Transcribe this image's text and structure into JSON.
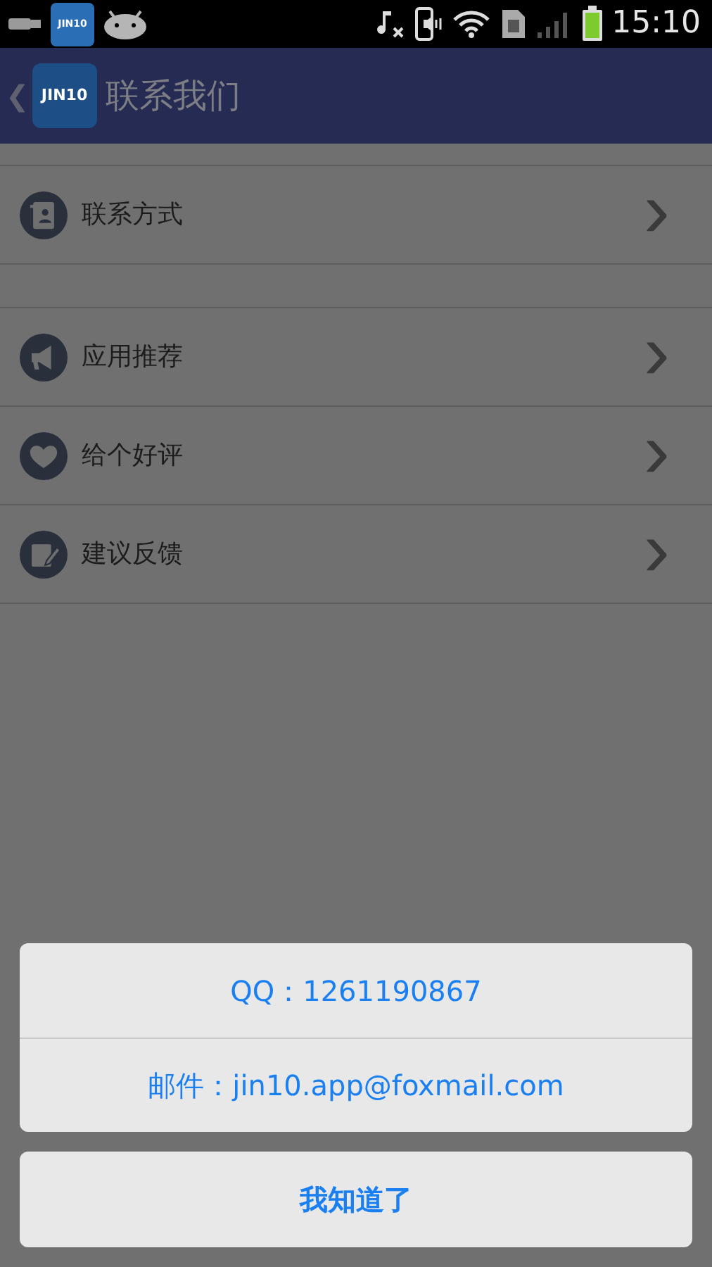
{
  "status_bar": {
    "app_logo_text": "JIN10",
    "time": "15:10"
  },
  "header": {
    "back": "❮",
    "logo_text": "JIN10",
    "title": "联系我们"
  },
  "menu_groups": [
    {
      "items": [
        {
          "label": "联系方式",
          "kind": "contacts",
          "chevron": "›"
        }
      ]
    },
    {
      "items": [
        {
          "label": "应用推荐",
          "kind": "megaphone",
          "chevron": "›"
        },
        {
          "label": "给个好评",
          "kind": "heart",
          "chevron": "›"
        },
        {
          "label": "建议反馈",
          "kind": "edit",
          "chevron": "›"
        }
      ]
    }
  ],
  "action_sheet": {
    "options": [
      "QQ：1261190867",
      "邮件：jin10.app@foxmail.com"
    ],
    "cancel": "我知道了"
  }
}
